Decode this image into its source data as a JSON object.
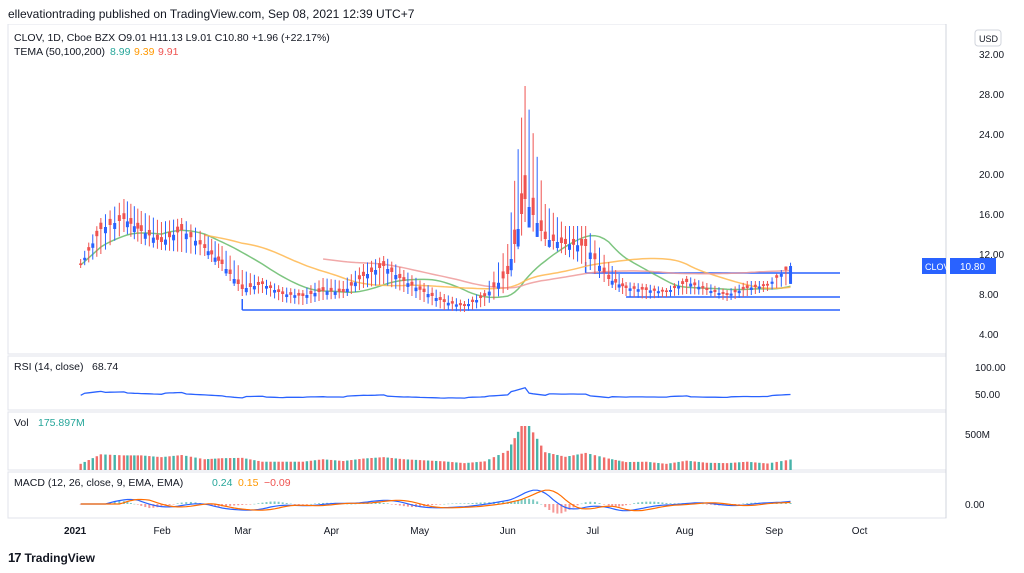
{
  "header": {
    "published_text": "ellevationtrading published on TradingView.com, Sep 08, 2021 12:39 UTC+7"
  },
  "footer": {
    "logo_text": "TradingView",
    "logo_mark": "17"
  },
  "main_legend": {
    "symbol_info": "CLOV, 1D, Cboe BZX",
    "ohlc": {
      "o_label": "O",
      "o": "9.01",
      "h_label": "H",
      "h": "11.13",
      "l_label": "L",
      "l": "9.01",
      "c_label": "C",
      "c": "10.80",
      "change": "+1.96 (+22.17%)"
    },
    "tema_label": "TEMA (50,100,200)",
    "tema_values": [
      "8.99",
      "9.39",
      "9.91"
    ]
  },
  "currency": "USD",
  "price_axis": [
    "32.00",
    "28.00",
    "24.00",
    "20.00",
    "16.00",
    "12.00",
    "8.00",
    "4.00"
  ],
  "last_price": {
    "symbol": "CLOV",
    "price": "10.80"
  },
  "rsi": {
    "label": "RSI (14, close)",
    "value": "68.74",
    "axis": [
      "100.00",
      "50.00"
    ]
  },
  "volume": {
    "label": "Vol",
    "value": "175.897M",
    "axis": [
      "500M"
    ]
  },
  "macd": {
    "label": "MACD (12, 26, close, 9, EMA, EMA)",
    "values": [
      "0.24",
      "0.15",
      "−0.09"
    ],
    "axis": [
      "0.00"
    ]
  },
  "time_axis": [
    "2021",
    "Feb",
    "Mar",
    "Apr",
    "May",
    "Jun",
    "Jul",
    "Aug",
    "Sep",
    "Oct"
  ],
  "colors": {
    "up": "#26a69a",
    "down": "#ef5350",
    "candle_up": "#2962ff",
    "candle_down": "#ef5350",
    "tema1": "#66bb6a",
    "tema2": "#ffb74d",
    "tema3": "#ef9a9a",
    "rsi": "#2962ff",
    "macd": "#2962ff",
    "signal": "#ff6d00",
    "trendline": "#2962ff",
    "text_green": "#26a69a",
    "text_orange": "#ff9800",
    "text_red": "#ef5350"
  },
  "chart_data": {
    "type": "candlestick",
    "dates": [
      "2021-01-04",
      "2021-01-11",
      "2021-01-19",
      "2021-01-25",
      "2021-02-01",
      "2021-02-08",
      "2021-02-16",
      "2021-02-22",
      "2021-03-01",
      "2021-03-08",
      "2021-03-15",
      "2021-03-22",
      "2021-03-29",
      "2021-04-05",
      "2021-04-12",
      "2021-04-19",
      "2021-04-26",
      "2021-05-03",
      "2021-05-10",
      "2021-05-17",
      "2021-05-24",
      "2021-06-01",
      "2021-06-07",
      "2021-06-14",
      "2021-06-21",
      "2021-06-28",
      "2021-07-06",
      "2021-07-12",
      "2021-07-19",
      "2021-07-26",
      "2021-08-02",
      "2021-08-09",
      "2021-08-16",
      "2021-08-23",
      "2021-08-30",
      "2021-09-07"
    ],
    "close": [
      10.9,
      14.5,
      15.5,
      14.3,
      13.2,
      14.4,
      12.6,
      11.0,
      8.5,
      9.0,
      8.0,
      7.8,
      8.3,
      8.2,
      9.8,
      10.8,
      9.3,
      8.2,
      7.2,
      6.8,
      7.8,
      10.0,
      17.5,
      13.5,
      13.0,
      12.8,
      9.5,
      8.6,
      8.4,
      8.2,
      9.2,
      8.4,
      7.9,
      8.6,
      8.84,
      10.8
    ],
    "high": [
      11.5,
      15.6,
      17.5,
      16.3,
      15.2,
      15.6,
      14.0,
      12.8,
      10.4,
      9.6,
      8.7,
      8.4,
      9.6,
      9.3,
      11.0,
      11.8,
      10.4,
      9.1,
      8.0,
      7.3,
      8.4,
      13.0,
      28.8,
      17.0,
      14.8,
      14.8,
      11.2,
      9.2,
      9.0,
      8.6,
      9.8,
      9.1,
      8.4,
      9.3,
      9.3,
      11.13
    ],
    "low": [
      10.6,
      12.0,
      14.2,
      13.0,
      12.4,
      12.2,
      11.8,
      10.3,
      7.8,
      8.1,
      7.2,
      6.9,
      7.4,
      7.6,
      8.6,
      9.0,
      8.2,
      7.2,
      6.4,
      6.2,
      6.8,
      8.4,
      15.2,
      12.8,
      11.9,
      10.8,
      8.8,
      7.8,
      7.5,
      7.7,
      8.0,
      7.9,
      7.3,
      7.8,
      8.3,
      9.01
    ],
    "tema": [
      {
        "name": "TEMA 50",
        "value": 8.99
      },
      {
        "name": "TEMA 100",
        "value": 9.39
      },
      {
        "name": "TEMA 200",
        "value": 9.91
      }
    ],
    "horizontal_levels": [
      10.1,
      7.7,
      6.4
    ],
    "rsi_last": 68.74,
    "volume_last": "175.897M",
    "macd_last": {
      "macd": 0.24,
      "signal": 0.15,
      "hist": -0.09
    },
    "ylim": [
      2,
      35
    ]
  }
}
